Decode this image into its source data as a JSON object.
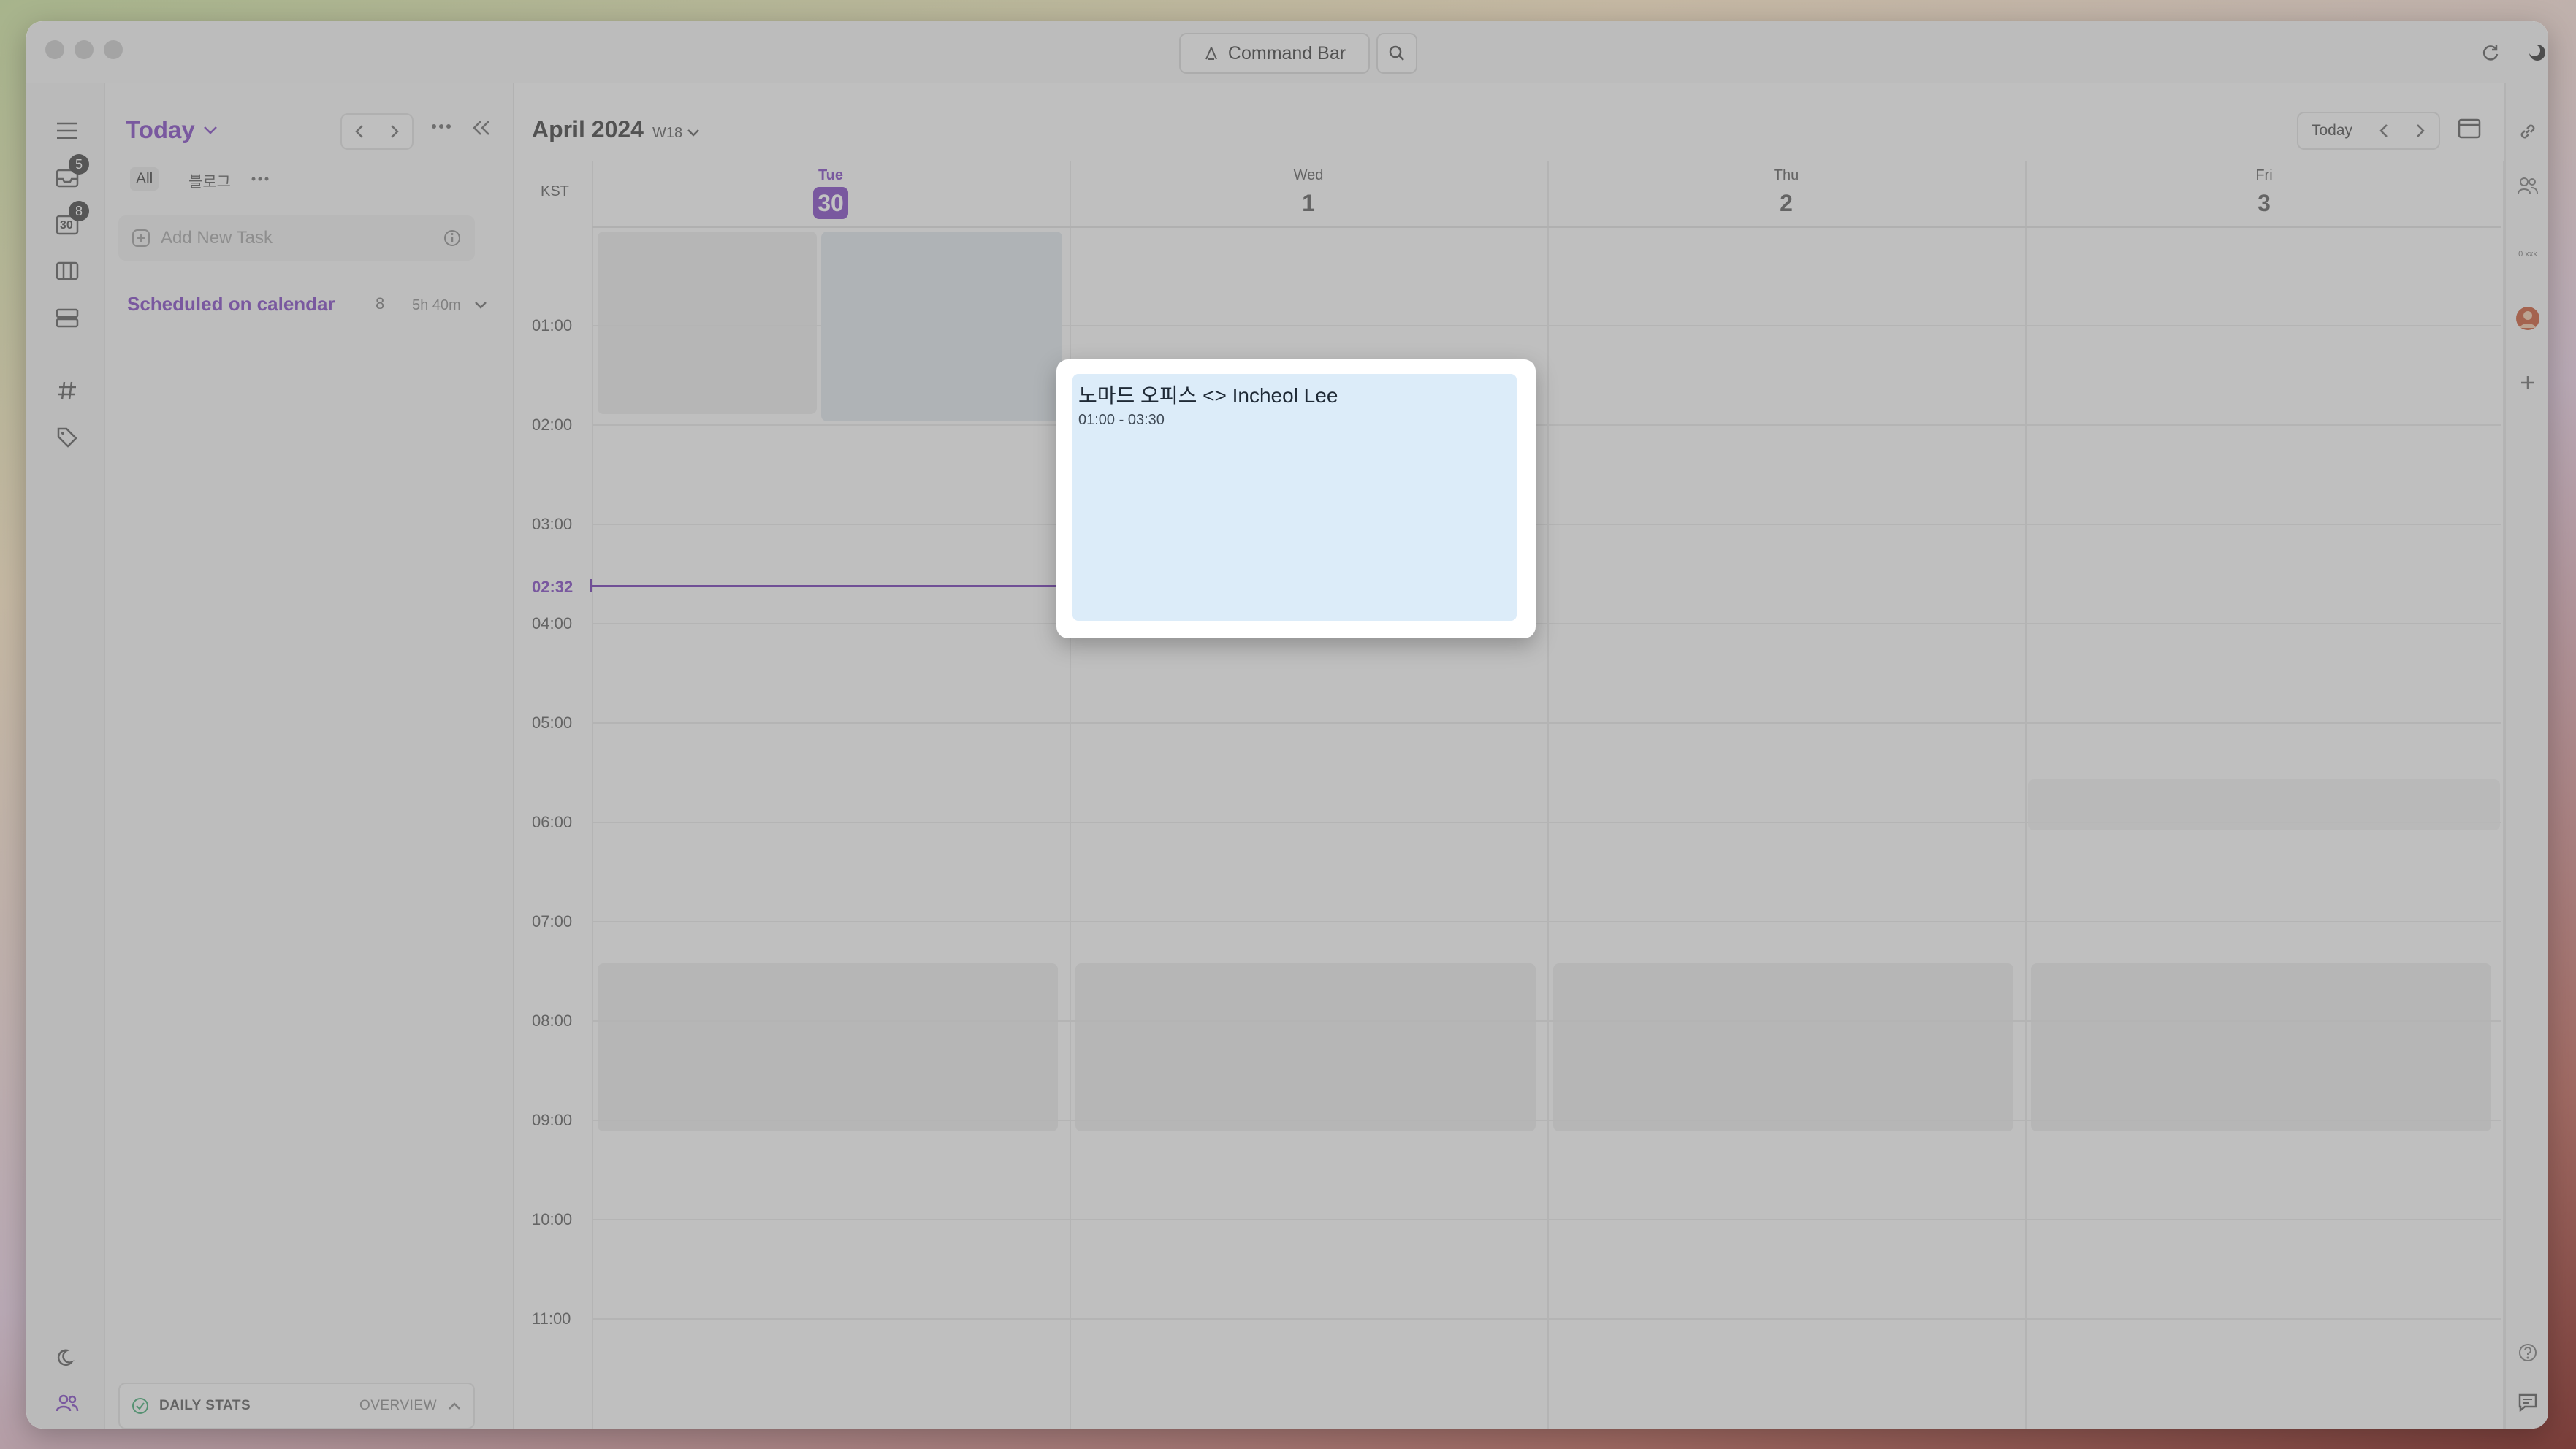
{
  "titlebar": {
    "command_bar_label": "Command Bar"
  },
  "leftrail": {
    "inbox_badge": "5",
    "calendar_badge": "8",
    "calendar_icon_text": "30"
  },
  "sidepanel": {
    "title": "Today",
    "filters": [
      "All",
      "블로그"
    ],
    "add_task_placeholder": "Add New Task",
    "scheduled_label": "Scheduled on calendar",
    "scheduled_count": "8",
    "scheduled_duration": "5h 40m",
    "daily_stats_label": "DAILY STATS",
    "overview_label": "OVERVIEW"
  },
  "calendar": {
    "month_title": "April 2024",
    "week_label": "W18",
    "today_button": "Today",
    "timezone": "KST",
    "days": [
      {
        "name": "Tue",
        "num": "30"
      },
      {
        "name": "Wed",
        "num": "1"
      },
      {
        "name": "Thu",
        "num": "2"
      },
      {
        "name": "Fri",
        "num": "3"
      }
    ],
    "hours": [
      "01:00",
      "02:00",
      "03:00",
      "04:00",
      "05:00",
      "06:00",
      "07:00",
      "08:00",
      "09:00",
      "10:00",
      "11:00"
    ],
    "now_label": "02:32"
  },
  "rightrail": {
    "zoom_label": "0 xxk"
  },
  "popup_event": {
    "title": "노마드 오피스 <> Incheol Lee",
    "time": "01:00 - 03:30"
  },
  "colors": {
    "accent": "#7a3fc0",
    "event_bg": "#dcecf9"
  }
}
